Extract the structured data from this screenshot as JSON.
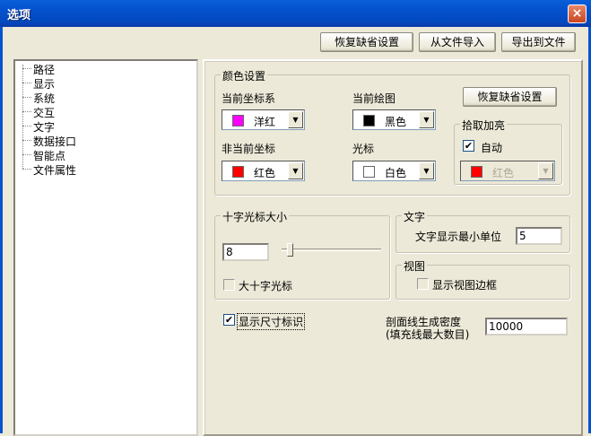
{
  "window": {
    "title": "选项",
    "close_icon": "×"
  },
  "toolbar": {
    "restore_default": "恢复缺省设置",
    "import": "从文件导入",
    "export": "导出到文件"
  },
  "tree": {
    "items": [
      "路径",
      "显示",
      "系统",
      "交互",
      "文字",
      "数据接口",
      "智能点",
      "文件属性"
    ],
    "selected": "显示"
  },
  "color_settings": {
    "legend": "颜色设置",
    "current_coord": {
      "label": "当前坐标系",
      "value": "洋红",
      "color": "#FF00FF"
    },
    "current_drawing": {
      "label": "当前绘图",
      "value": "黑色",
      "color": "#000000"
    },
    "non_current_coord": {
      "label": "非当前坐标",
      "value": "红色",
      "color": "#FF0000"
    },
    "cursor": {
      "label": "光标",
      "value": "白色",
      "color": "#FFFFFF"
    },
    "restore_button": "恢复缺省设置",
    "highlight": {
      "legend": "拾取加亮",
      "auto_label": "自动",
      "auto_checked": true,
      "value": "红色",
      "color": "#FF0000"
    }
  },
  "crosshair": {
    "legend": "十字光标大小",
    "size": "8",
    "slider_fraction": 0.06,
    "big_label": "大十字光标",
    "big_checked": false
  },
  "text": {
    "legend": "文字",
    "min_unit_label": "文字显示最小单位",
    "min_unit": "5"
  },
  "view": {
    "legend": "视图",
    "show_frame_label": "显示视图边框",
    "show_frame_checked": false
  },
  "show_dimension": {
    "label": "显示尺寸标识",
    "checked": true
  },
  "hatch": {
    "label_line1": "剖面线生成密度",
    "label_line2": "(填充线最大数目)",
    "value": "10000"
  },
  "check_mark": "✔"
}
